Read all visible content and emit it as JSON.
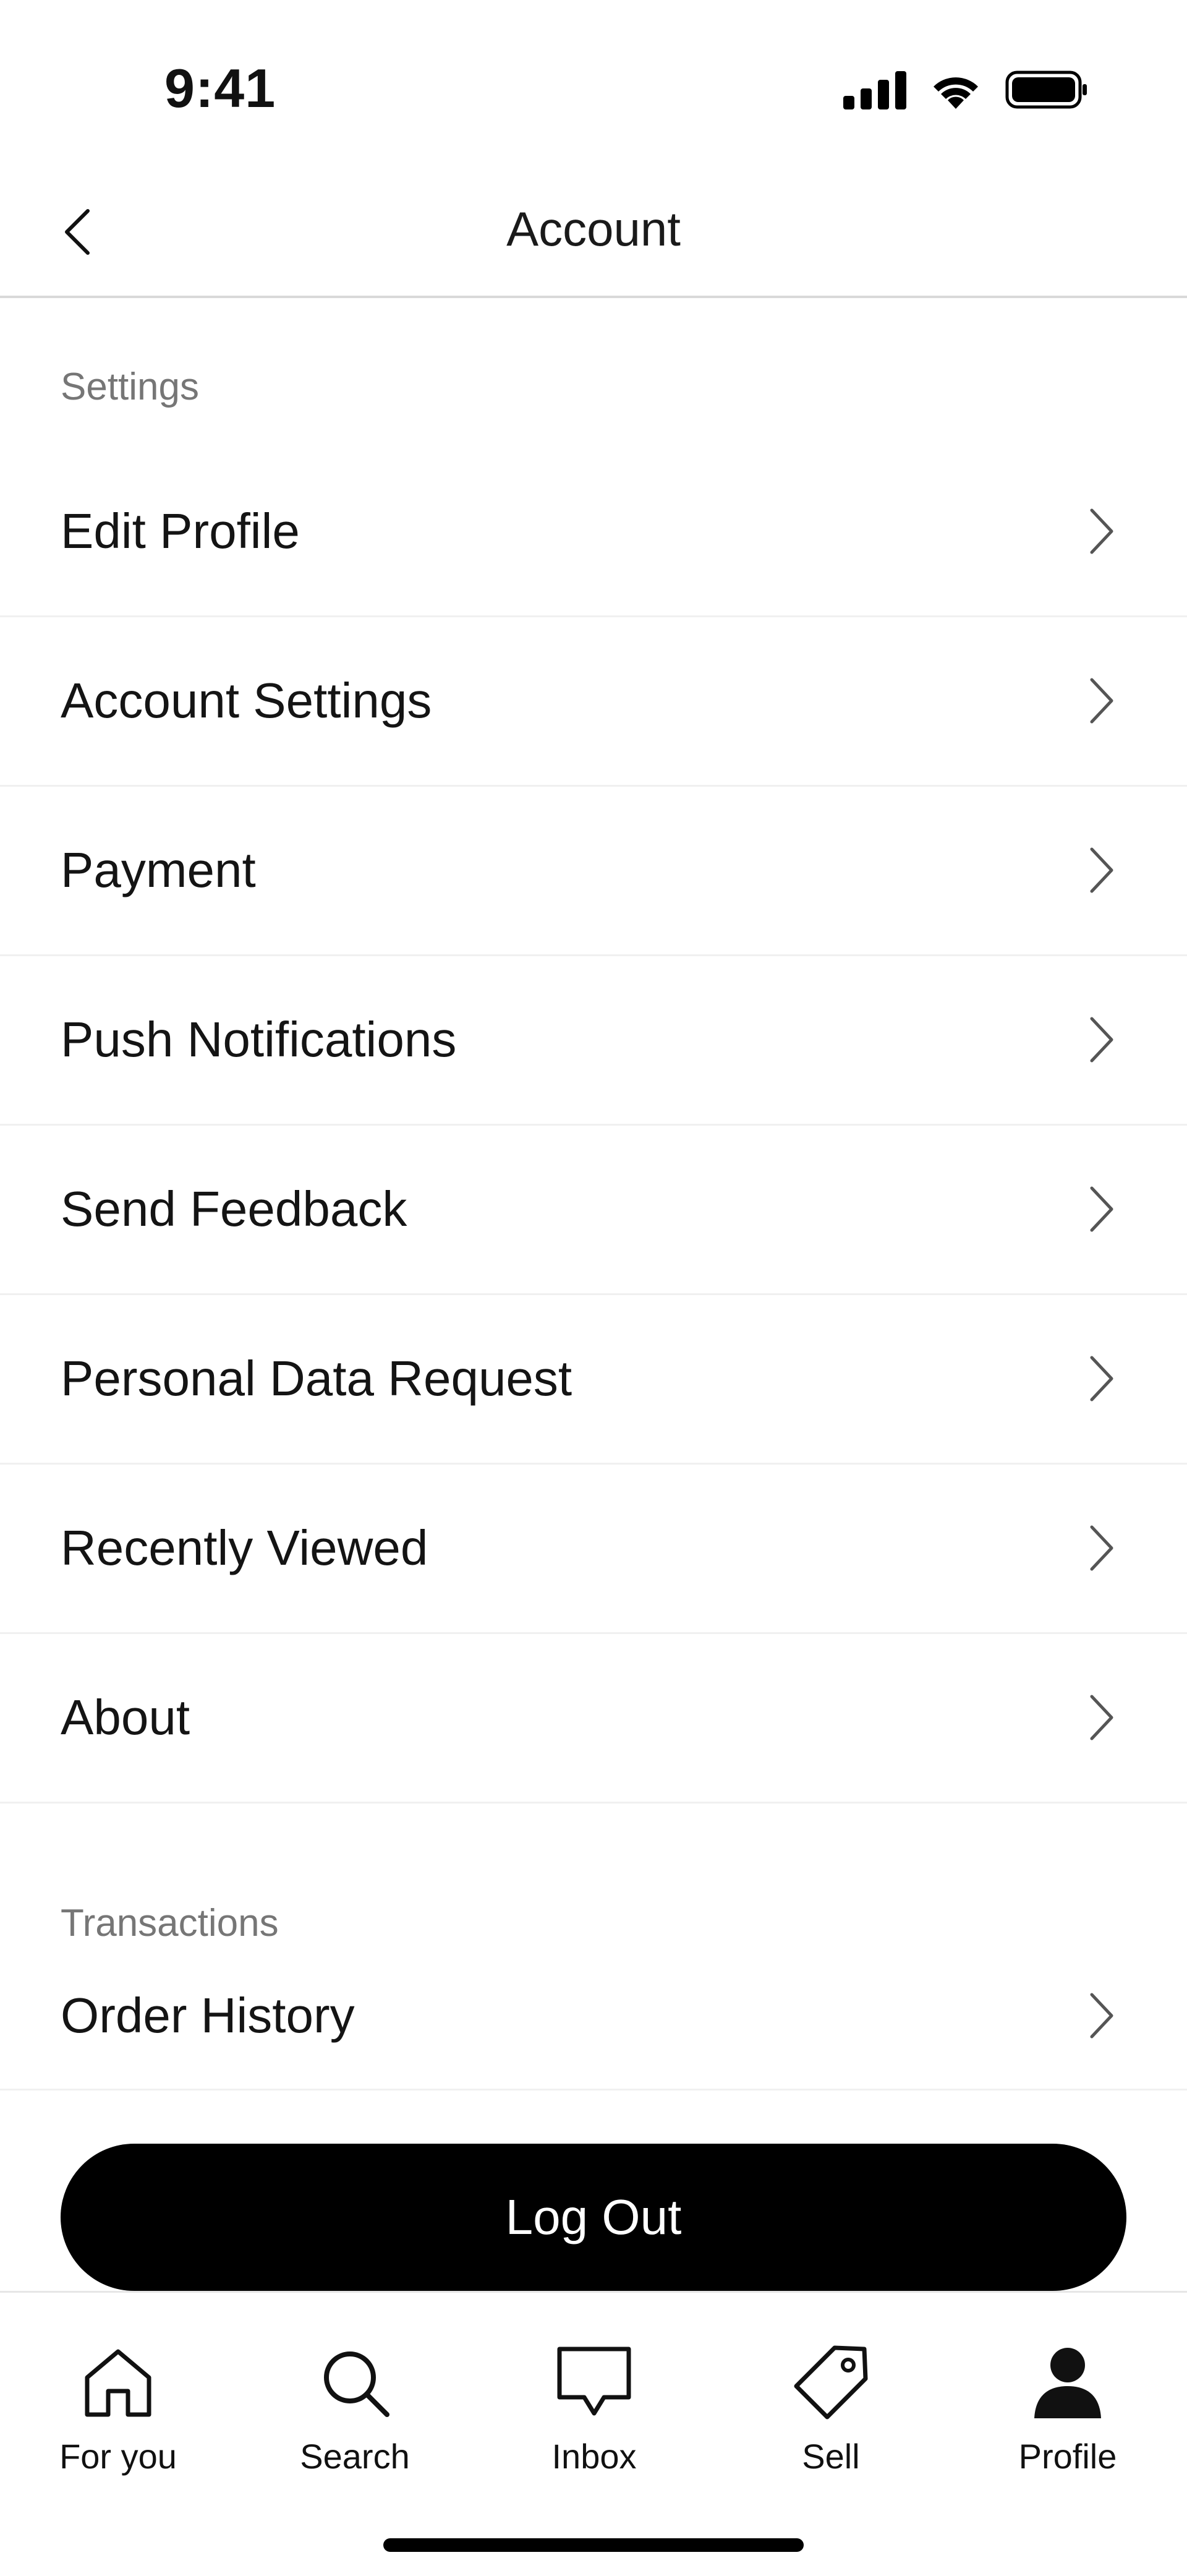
{
  "status_bar": {
    "time": "9:41"
  },
  "header": {
    "title": "Account"
  },
  "sections": {
    "settings": {
      "label": "Settings",
      "items": [
        {
          "label": "Edit Profile"
        },
        {
          "label": "Account Settings"
        },
        {
          "label": "Payment"
        },
        {
          "label": "Push Notifications"
        },
        {
          "label": "Send Feedback"
        },
        {
          "label": "Personal Data Request"
        },
        {
          "label": "Recently Viewed"
        },
        {
          "label": "About"
        }
      ]
    },
    "transactions": {
      "label": "Transactions",
      "items": [
        {
          "label": "Order History"
        }
      ]
    }
  },
  "logout": {
    "label": "Log Out"
  },
  "tabs": [
    {
      "label": "For you",
      "icon": "home-icon"
    },
    {
      "label": "Search",
      "icon": "search-icon"
    },
    {
      "label": "Inbox",
      "icon": "inbox-icon"
    },
    {
      "label": "Sell",
      "icon": "tag-icon"
    },
    {
      "label": "Profile",
      "icon": "profile-icon",
      "active": true
    }
  ]
}
